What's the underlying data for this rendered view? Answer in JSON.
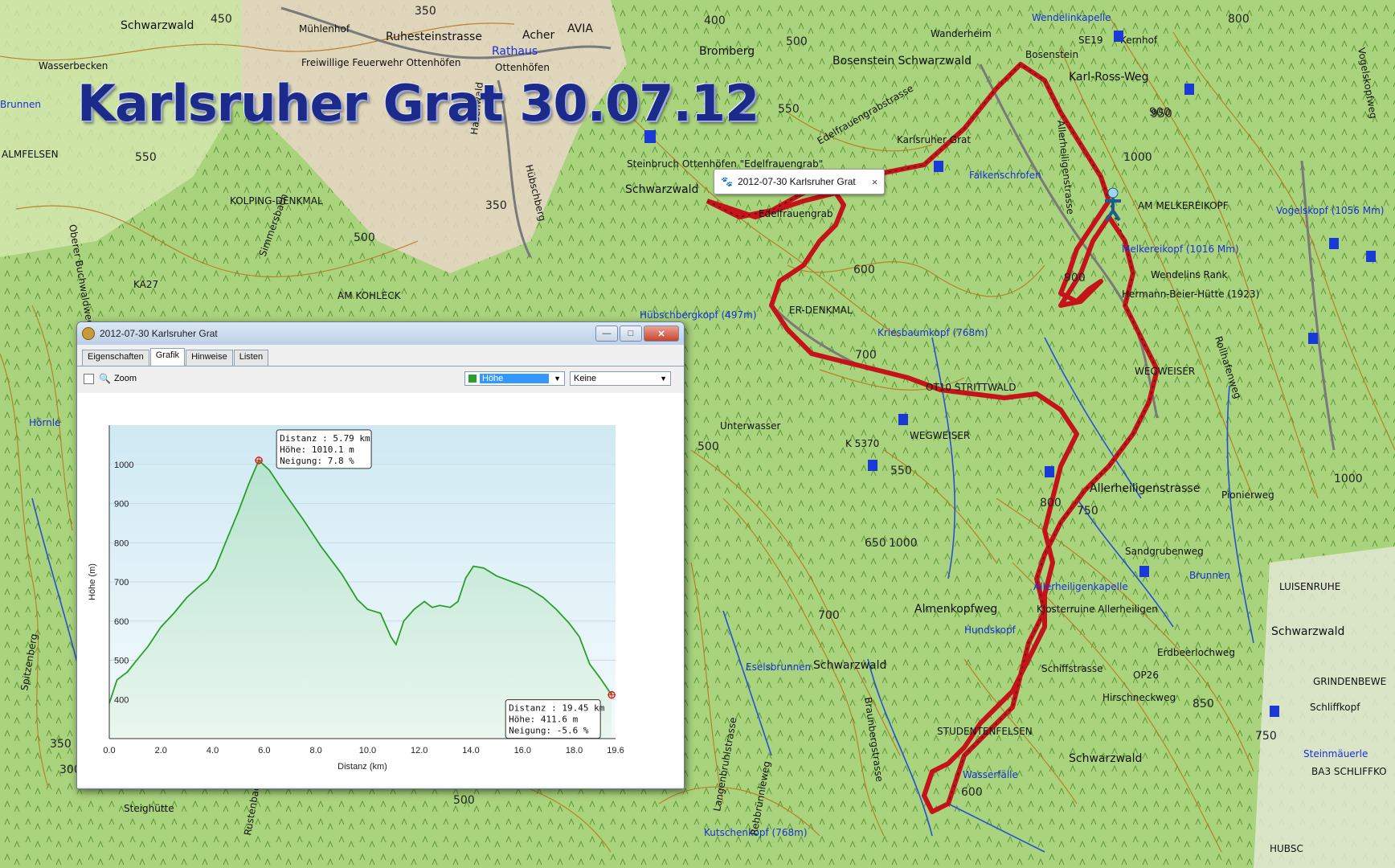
{
  "map": {
    "title": "Karlsruher Grat 30.07.12",
    "labels": {
      "schwarzwald_tl": "Schwarzwald",
      "muehlenhof": "Mühlenhof",
      "ruhesteinstrasse": "Ruhesteinstrasse",
      "acher": "Acher",
      "avia": "AVIA",
      "rathaus": "Rathaus",
      "feuerwehr": "Freiwillige Feuerwehr Ottenhöfen",
      "ottenhoefen": "Ottenhöfen",
      "edelfrauengrabstrasse": "Edelfrauengrabstrasse",
      "bromberg": "Bromberg",
      "wanderheim": "Wanderheim",
      "wendelinkapelle": "Wendelinkapelle",
      "se19": "SE19",
      "kernhof": "Kernhof",
      "bosenstein_sw": "Bosenstein Schwarzwald",
      "bosenstein": "Bosenstein",
      "karl_ross_weg": "Karl-Ross-Weg",
      "wassertrecken": "Wasserbecken",
      "brunnen_l": "Brunnen",
      "almfelsen": "ALMFELSEN",
      "kolping": "KOLPING-DENKMAL",
      "ka27": "KA27",
      "am_kohleck": "AM KOHLECK",
      "steinbruch": "Steinbruch Ottenhöfen \"Edelfrauengrab\"",
      "schwarzwald_mid": "Schwarzwald",
      "edelfrauengrab": "Edelfrauengrab",
      "falkenschrofen": "Falkenschrofen",
      "karlsruher_grat": "Karlsruher Grat",
      "am_melkereikopf": "AM MELKEREIKOPF",
      "vogelskopf": "Vogelskopf (1056 Mm)",
      "melkereikopf": "Melkereikopf (1016 Mm)",
      "wendelins_rank": "Wendelins Rank",
      "hermann_beier": "Hermann-Beier-Hütte (1923)",
      "huebschbergkopf": "Hübschbergkopf (497m)",
      "denkmal": "ER-DENKMAL",
      "kriesbaumkopf": "Kriesbaumkopf (768m)",
      "ot10": "OT10 STRITTWALD",
      "wegweiser_r": "WEGWEISER",
      "wegweiser_m": "WEGWEISER",
      "k5370": "K 5370",
      "unterwasser": "Unterwasser",
      "allerheiligenstrasse": "Allerheiligenstrasse",
      "hornle": "Hörnle",
      "sandgrubenweg": "Sandgrubenweg",
      "pionierweg": "Pionierweg",
      "allerheiligenkapelle": "Allerheiligenkapelle",
      "klosterruine": "Klosterruine Allerheiligen",
      "brunnen_r": "Brunnen",
      "luisenruhe": "LUISENRUHE",
      "almenkopfweg": "Almenkopfweg",
      "hundskopf": "Hundskopf",
      "schwarzwald_r": "Schwarzwald",
      "eselsbrunnen": "Eselsbrunnen",
      "schwarzwald_low": "Schwarzwald",
      "schiffstrasse": "Schiffstrasse",
      "op26": "OP26",
      "erdbeerlochweg": "Erdbeerlochweg",
      "grindenbewe": "GRINDENBEWE",
      "schliffkopf": "Schliffkopf",
      "studentenfelsen": "STUDENTENFELSEN",
      "hirschneckweg": "Hirschneckweg",
      "steinmauerle": "Steinmäuerle",
      "ba3": "BA3 SCHLIFFKO",
      "schwarzwald_br": "Schwarzwald",
      "wasserfaelle": "Wasserfälle",
      "kutschenkopf": "Kutschenkopf (768m)",
      "steighuette": "Steighütte",
      "rollhafenweg": "Rollhafenweg",
      "vogelskopfweg": "Vogelskopfweg",
      "huebschberg": "Hübschberg",
      "hasenwald": "Hasenwald",
      "schwarzwald_low2": "Schwarzwald",
      "rustenbach": "Rustenbach",
      "langenruhstrasse": "Langenbruhlstrasse",
      "rehbrunnenweg": "Rehbrünnleweg",
      "braunbergstrasse": "Braunbergstrasse",
      "simmersbach": "Simmersbach",
      "buchwaldweg": "Oberer Buchwaldweg",
      "spitzenberg": "Spitzenberg",
      "hubsc": "HUBSC"
    },
    "contours": [
      "450",
      "350",
      "400",
      "500",
      "550",
      "550",
      "350",
      "500",
      "600",
      "700",
      "800",
      "900",
      "1000",
      "950",
      "800",
      "750",
      "650",
      "550",
      "900",
      "1000",
      "850",
      "600",
      "700",
      "750",
      "500",
      "1000",
      "350",
      "300",
      "500"
    ],
    "callout": {
      "label": "2012-07-30 Karlsruher Grat",
      "close": "×"
    },
    "colors": {
      "track": "#c4141a",
      "contour": "#b87a22",
      "stream": "#2a4fd6",
      "road": "#6b6b6b"
    }
  },
  "window": {
    "title": "2012-07-30 Karlsruher Grat",
    "controls": {
      "minimize": "—",
      "maximize": "□",
      "close": "✕"
    },
    "tabs": [
      "Eigenschaften",
      "Grafik",
      "Hinweise",
      "Listen"
    ],
    "active_tab": "Grafik",
    "zoom_label": "Zoom",
    "series_select": "Höhe",
    "compare_select": "Keine"
  },
  "chart_data": {
    "type": "area",
    "xlabel": "Distanz  (km)",
    "ylabel": "Höhe (m)",
    "xlim": [
      0,
      19.6
    ],
    "ylim": [
      300,
      1100
    ],
    "x_ticks": [
      "0.0",
      "2.0",
      "4.0",
      "6.0",
      "8.0",
      "10.0",
      "12.0",
      "14.0",
      "16.0",
      "18.0",
      "19.6"
    ],
    "x_tick_values": [
      0,
      2,
      4,
      6,
      8,
      10,
      12,
      14,
      16,
      18,
      19.6
    ],
    "y_ticks": [
      "400",
      "500",
      "600",
      "700",
      "800",
      "900",
      "1000"
    ],
    "y_tick_values": [
      400,
      500,
      600,
      700,
      800,
      900,
      1000
    ],
    "grid": true,
    "series": [
      {
        "x": [
          0,
          0.3,
          0.7,
          1.0,
          1.5,
          2.0,
          2.5,
          3.0,
          3.5,
          3.8,
          4.1,
          4.5,
          5.0,
          5.4,
          5.79,
          6.2,
          6.8,
          7.5,
          8.2,
          9.0,
          9.6,
          10.0,
          10.5,
          10.9,
          11.1,
          11.4,
          11.8,
          12.2,
          12.5,
          12.8,
          13.2,
          13.5,
          13.8,
          14.1,
          14.5,
          15.0,
          15.6,
          16.2,
          16.8,
          17.3,
          17.8,
          18.2,
          18.6,
          19.0,
          19.45
        ],
        "y": [
          390,
          450,
          470,
          495,
          535,
          585,
          620,
          660,
          690,
          705,
          735,
          800,
          880,
          950,
          1010.1,
          985,
          925,
          860,
          790,
          720,
          655,
          630,
          620,
          560,
          540,
          600,
          630,
          650,
          635,
          640,
          635,
          650,
          710,
          740,
          735,
          715,
          700,
          685,
          660,
          630,
          595,
          560,
          490,
          455,
          411.6
        ]
      }
    ],
    "annotations": [
      {
        "distance": "Distanz : 5.79 km",
        "height": "Höhe: 1010.1 m",
        "slope": "Neigung: 7.8 %",
        "x": 5.79,
        "y": 1010.1
      },
      {
        "distance": "Distanz : 19.45 km",
        "height": "Höhe: 411.6 m",
        "slope": "Neigung: -5.6 %",
        "x": 19.45,
        "y": 411.6
      }
    ]
  }
}
